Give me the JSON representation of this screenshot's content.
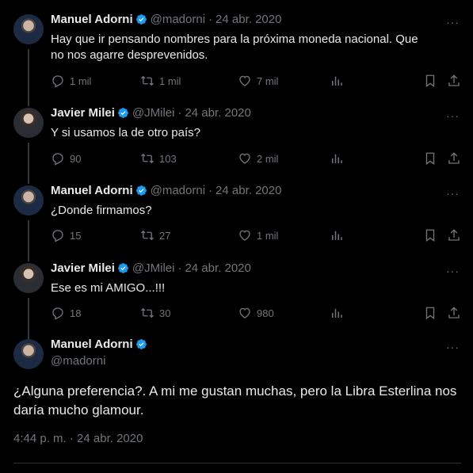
{
  "thread": [
    {
      "name": "Manuel Adorni",
      "handle": "@madorni",
      "date": "24 abr. 2020",
      "text": "Hay que ir pensando nombres para la próxima moneda nacional. Que no nos agarre desprevenidos.",
      "reply_count": "1 mil",
      "retweet_count": "1 mil",
      "like_count": "7 mil"
    },
    {
      "name": "Javier Milei",
      "handle": "@JMilei",
      "date": "24 abr. 2020",
      "text": "Y si usamos la de otro país?",
      "reply_count": "90",
      "retweet_count": "103",
      "like_count": "2 mil"
    },
    {
      "name": "Manuel Adorni",
      "handle": "@madorni",
      "date": "24 abr. 2020",
      "text": "¿Donde firmamos?",
      "reply_count": "15",
      "retweet_count": "27",
      "like_count": "1 mil"
    },
    {
      "name": "Javier Milei",
      "handle": "@JMilei",
      "date": "24 abr. 2020",
      "text": "Ese es mi AMIGO...!!!",
      "reply_count": "18",
      "retweet_count": "30",
      "like_count": "980"
    }
  ],
  "main_tweet": {
    "name": "Manuel Adorni",
    "handle": "@madorni",
    "text": "¿Alguna preferencia?. A mi me gustan muchas, pero la Libra Esterlina nos daría mucho glamour.",
    "timestamp": "4:44 p. m. · 24 abr. 2020"
  },
  "separator": "·",
  "more_label": "···",
  "colors": {
    "background": "#000000",
    "text": "#e7e9ea",
    "muted": "#71767b",
    "verified": "#1d9bf0"
  },
  "icons": [
    "reply-icon",
    "retweet-icon",
    "like-icon",
    "views-icon",
    "bookmark-icon",
    "share-icon",
    "verified-badge-icon",
    "more-icon"
  ]
}
